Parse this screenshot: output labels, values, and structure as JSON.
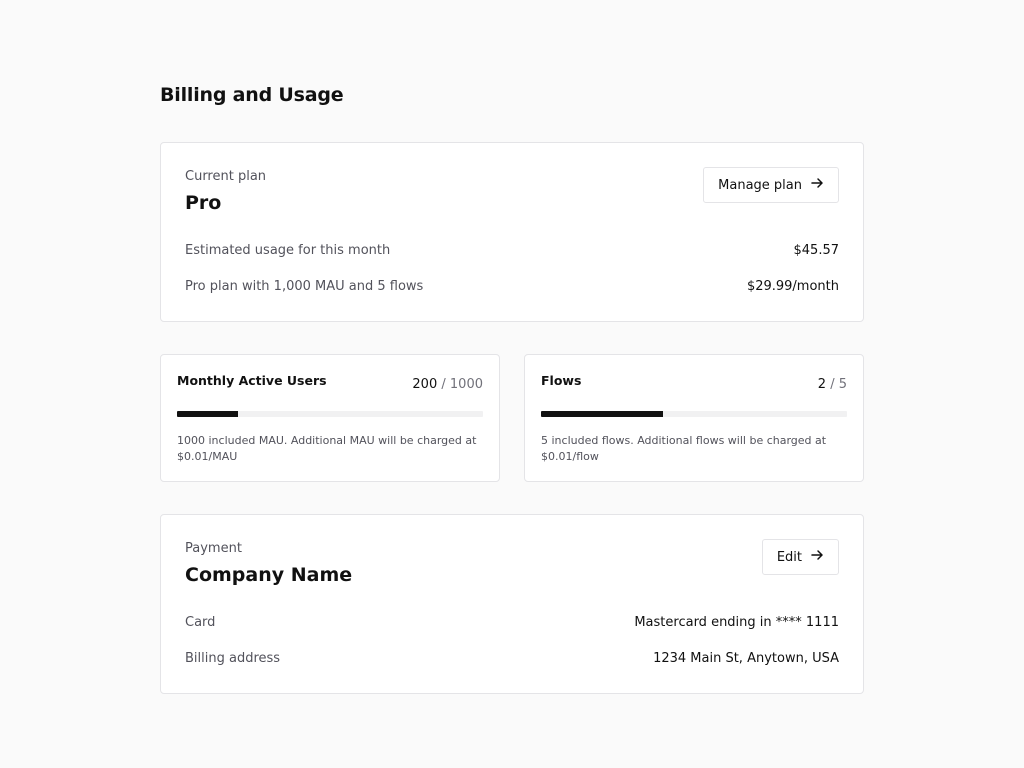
{
  "page": {
    "title": "Billing and Usage"
  },
  "plan": {
    "eyebrow": "Current plan",
    "name": "Pro",
    "manage_label": "Manage plan",
    "rows": [
      {
        "label": "Estimated usage for this month",
        "value": "$45.57"
      },
      {
        "label": "Pro plan with 1,000 MAU and 5 flows",
        "value": "$29.99/month"
      }
    ]
  },
  "usage": {
    "mau": {
      "title": "Monthly Active Users",
      "used": "200",
      "separator": "/",
      "limit": "1000",
      "fraction": 0.2,
      "note": "1000 included MAU. Additional MAU will be charged at $0.01/MAU"
    },
    "flows": {
      "title": "Flows",
      "used": "2",
      "separator": "/",
      "limit": "5",
      "fraction": 0.4,
      "note": "5 included flows. Additional flows will be charged at $0.01/flow"
    }
  },
  "payment": {
    "eyebrow": "Payment",
    "name": "Company Name",
    "edit_label": "Edit",
    "rows": [
      {
        "label": "Card",
        "value": "Mastercard ending in **** 1111"
      },
      {
        "label": "Billing address",
        "value": "1234 Main St, Anytown, USA"
      }
    ]
  },
  "icons": {
    "arrow": "arrow-right-icon"
  },
  "colors": {
    "progress_fill": "#111111",
    "progress_track": "#f1f1f2"
  }
}
